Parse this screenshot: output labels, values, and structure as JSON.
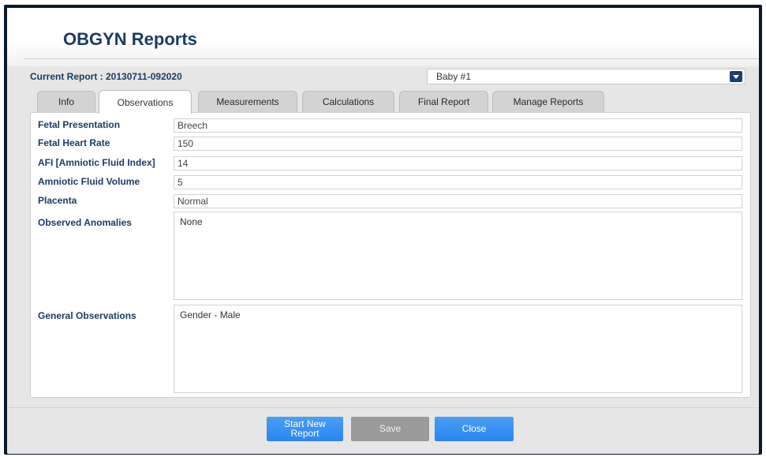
{
  "app": {
    "title": "OBGYN Reports"
  },
  "report": {
    "current_label": "Current Report : 20130711-092020",
    "baby_selected": "Baby #1"
  },
  "tabs": [
    {
      "label": "Info",
      "active": false
    },
    {
      "label": "Observations",
      "active": true
    },
    {
      "label": "Measurements",
      "active": false
    },
    {
      "label": "Calculations",
      "active": false
    },
    {
      "label": "Final Report",
      "active": false
    },
    {
      "label": "Manage Reports",
      "active": false
    }
  ],
  "fields": {
    "fetal_presentation": {
      "label": "Fetal Presentation",
      "value": "Breech"
    },
    "fetal_heart_rate": {
      "label": "Fetal Heart Rate",
      "value": "150"
    },
    "afi": {
      "label": "AFI [Amniotic Fluid Index]",
      "value": "14"
    },
    "amniotic_fluid_volume": {
      "label": "Amniotic Fluid Volume",
      "value": "5"
    },
    "placenta": {
      "label": "Placenta",
      "value": "Normal"
    },
    "observed_anomalies": {
      "label": "Observed Anomalies",
      "value": "None"
    },
    "general_observations": {
      "label": "General Observations",
      "value": "Gender - Male"
    }
  },
  "buttons": {
    "start_new_line1": "Start New",
    "start_new_line2": "Report",
    "save": "Save",
    "close": "Close"
  },
  "colors": {
    "title": "#1a3c63",
    "button_blue": "#2a85f0",
    "button_disabled": "#9a9a9a",
    "frame": "#0b1a2a"
  }
}
